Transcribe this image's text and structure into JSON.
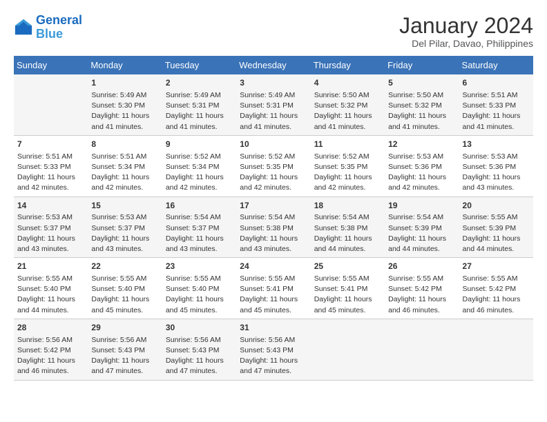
{
  "header": {
    "logo_line1": "General",
    "logo_line2": "Blue",
    "month_title": "January 2024",
    "location": "Del Pilar, Davao, Philippines"
  },
  "days_of_week": [
    "Sunday",
    "Monday",
    "Tuesday",
    "Wednesday",
    "Thursday",
    "Friday",
    "Saturday"
  ],
  "weeks": [
    [
      {
        "day": "",
        "info": ""
      },
      {
        "day": "1",
        "info": "Sunrise: 5:49 AM\nSunset: 5:30 PM\nDaylight: 11 hours\nand 41 minutes."
      },
      {
        "day": "2",
        "info": "Sunrise: 5:49 AM\nSunset: 5:31 PM\nDaylight: 11 hours\nand 41 minutes."
      },
      {
        "day": "3",
        "info": "Sunrise: 5:49 AM\nSunset: 5:31 PM\nDaylight: 11 hours\nand 41 minutes."
      },
      {
        "day": "4",
        "info": "Sunrise: 5:50 AM\nSunset: 5:32 PM\nDaylight: 11 hours\nand 41 minutes."
      },
      {
        "day": "5",
        "info": "Sunrise: 5:50 AM\nSunset: 5:32 PM\nDaylight: 11 hours\nand 41 minutes."
      },
      {
        "day": "6",
        "info": "Sunrise: 5:51 AM\nSunset: 5:33 PM\nDaylight: 11 hours\nand 41 minutes."
      }
    ],
    [
      {
        "day": "7",
        "info": "Sunrise: 5:51 AM\nSunset: 5:33 PM\nDaylight: 11 hours\nand 42 minutes."
      },
      {
        "day": "8",
        "info": "Sunrise: 5:51 AM\nSunset: 5:34 PM\nDaylight: 11 hours\nand 42 minutes."
      },
      {
        "day": "9",
        "info": "Sunrise: 5:52 AM\nSunset: 5:34 PM\nDaylight: 11 hours\nand 42 minutes."
      },
      {
        "day": "10",
        "info": "Sunrise: 5:52 AM\nSunset: 5:35 PM\nDaylight: 11 hours\nand 42 minutes."
      },
      {
        "day": "11",
        "info": "Sunrise: 5:52 AM\nSunset: 5:35 PM\nDaylight: 11 hours\nand 42 minutes."
      },
      {
        "day": "12",
        "info": "Sunrise: 5:53 AM\nSunset: 5:36 PM\nDaylight: 11 hours\nand 42 minutes."
      },
      {
        "day": "13",
        "info": "Sunrise: 5:53 AM\nSunset: 5:36 PM\nDaylight: 11 hours\nand 43 minutes."
      }
    ],
    [
      {
        "day": "14",
        "info": "Sunrise: 5:53 AM\nSunset: 5:37 PM\nDaylight: 11 hours\nand 43 minutes."
      },
      {
        "day": "15",
        "info": "Sunrise: 5:53 AM\nSunset: 5:37 PM\nDaylight: 11 hours\nand 43 minutes."
      },
      {
        "day": "16",
        "info": "Sunrise: 5:54 AM\nSunset: 5:37 PM\nDaylight: 11 hours\nand 43 minutes."
      },
      {
        "day": "17",
        "info": "Sunrise: 5:54 AM\nSunset: 5:38 PM\nDaylight: 11 hours\nand 43 minutes."
      },
      {
        "day": "18",
        "info": "Sunrise: 5:54 AM\nSunset: 5:38 PM\nDaylight: 11 hours\nand 44 minutes."
      },
      {
        "day": "19",
        "info": "Sunrise: 5:54 AM\nSunset: 5:39 PM\nDaylight: 11 hours\nand 44 minutes."
      },
      {
        "day": "20",
        "info": "Sunrise: 5:55 AM\nSunset: 5:39 PM\nDaylight: 11 hours\nand 44 minutes."
      }
    ],
    [
      {
        "day": "21",
        "info": "Sunrise: 5:55 AM\nSunset: 5:40 PM\nDaylight: 11 hours\nand 44 minutes."
      },
      {
        "day": "22",
        "info": "Sunrise: 5:55 AM\nSunset: 5:40 PM\nDaylight: 11 hours\nand 45 minutes."
      },
      {
        "day": "23",
        "info": "Sunrise: 5:55 AM\nSunset: 5:40 PM\nDaylight: 11 hours\nand 45 minutes."
      },
      {
        "day": "24",
        "info": "Sunrise: 5:55 AM\nSunset: 5:41 PM\nDaylight: 11 hours\nand 45 minutes."
      },
      {
        "day": "25",
        "info": "Sunrise: 5:55 AM\nSunset: 5:41 PM\nDaylight: 11 hours\nand 45 minutes."
      },
      {
        "day": "26",
        "info": "Sunrise: 5:55 AM\nSunset: 5:42 PM\nDaylight: 11 hours\nand 46 minutes."
      },
      {
        "day": "27",
        "info": "Sunrise: 5:55 AM\nSunset: 5:42 PM\nDaylight: 11 hours\nand 46 minutes."
      }
    ],
    [
      {
        "day": "28",
        "info": "Sunrise: 5:56 AM\nSunset: 5:42 PM\nDaylight: 11 hours\nand 46 minutes."
      },
      {
        "day": "29",
        "info": "Sunrise: 5:56 AM\nSunset: 5:43 PM\nDaylight: 11 hours\nand 47 minutes."
      },
      {
        "day": "30",
        "info": "Sunrise: 5:56 AM\nSunset: 5:43 PM\nDaylight: 11 hours\nand 47 minutes."
      },
      {
        "day": "31",
        "info": "Sunrise: 5:56 AM\nSunset: 5:43 PM\nDaylight: 11 hours\nand 47 minutes."
      },
      {
        "day": "",
        "info": ""
      },
      {
        "day": "",
        "info": ""
      },
      {
        "day": "",
        "info": ""
      }
    ]
  ]
}
